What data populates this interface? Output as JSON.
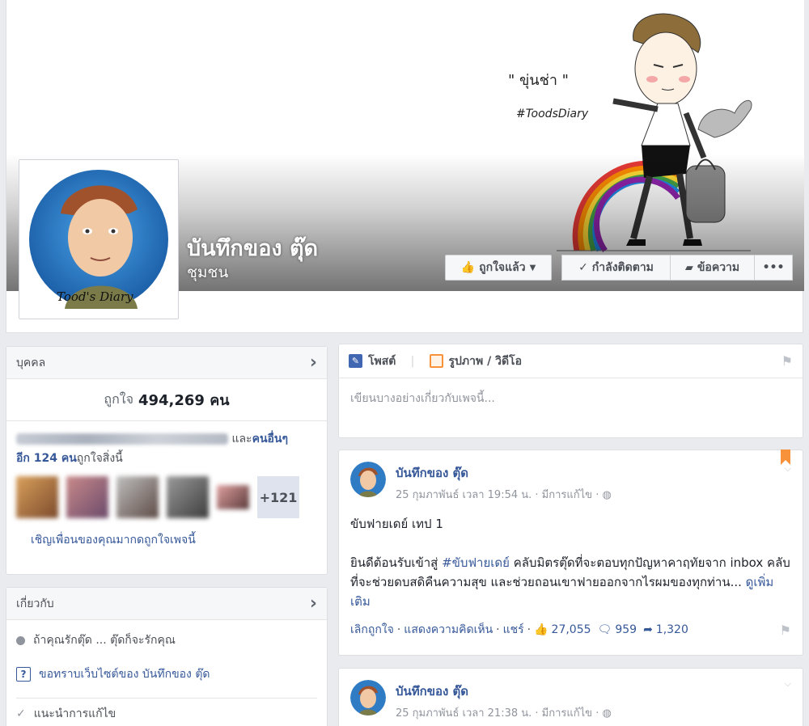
{
  "page": {
    "title": "บันทึกของ ตุ๊ด",
    "category": "ชุมชน",
    "cover_caption": "\" ขุ่นช่า \"",
    "cover_hashtag": "#ToodsDiary",
    "profile_signature": "Tood's Diary"
  },
  "actions": {
    "like_label": "ถูกใจแล้ว",
    "follow_label": "กำลังติดตาม",
    "message_label": "ข้อความ",
    "more_label": "•••"
  },
  "people": {
    "header": "บุคคล",
    "likes_prefix": "ถูกใจ",
    "likes_count": "494,269 คน",
    "friends_and": "และ",
    "friends_others": "คนอื่นๆ",
    "friends_line2_bold": "อีก 124 คน",
    "friends_line2_rest": "ถูกใจสิ่งนี้",
    "more_count": "+121",
    "invite_label": "เชิญเพื่อนของคุณมากดถูกใจเพจนี้"
  },
  "about": {
    "header": "เกี่ยวกับ",
    "description": "ถ้าคุณรักตุ๊ด ... ตุ๊ดก็จะรักคุณ",
    "website_request": "ขอทราบเว็บไซต์ของ บันทึกของ ตุ๊ด",
    "suggest_edits": "แนะนำการแก้ไข"
  },
  "composer": {
    "tab_post": "โพสต์",
    "tab_photo": "รูปภาพ / วิดีโอ",
    "placeholder": "เขียนบางอย่างเกี่ยวกับเพจนี้..."
  },
  "posts": [
    {
      "author": "บันทึกของ ตุ๊ด",
      "meta": "25 กุมภาพันธ์ เวลา 19:54 น. · มีการแก้ไข ·",
      "title_line": "ขับฟายเดย์ เทป 1",
      "body_start": "ยินดีต้อนรับเข้าสู่ ",
      "hashtag": "#ขับฟายเดย์",
      "body_rest": " คลับมิตรตุ๊ดที่จะตอบทุกปัญหาคาฤทัยจาก inbox คลับที่จะช่วยดบสดิคืนความสุข และช่วยถอนเขาฟายออกจากไรผมของทุกท่าน... ",
      "see_more": "ดูเพิ่มเติม",
      "unlike": "เลิกถูกใจ",
      "comment": "แสดงความคิดเห็น",
      "share": "แชร์",
      "likes": "27,055",
      "comments": "959",
      "shares": "1,320"
    },
    {
      "author": "บันทึกของ ตุ๊ด",
      "meta": "25 กุมภาพันธ์ เวลา 21:38 น. · มีการแก้ไข ·"
    }
  ],
  "colors": {
    "link": "#365899",
    "background": "#e9ebee",
    "bookmark": "#f7923b"
  }
}
